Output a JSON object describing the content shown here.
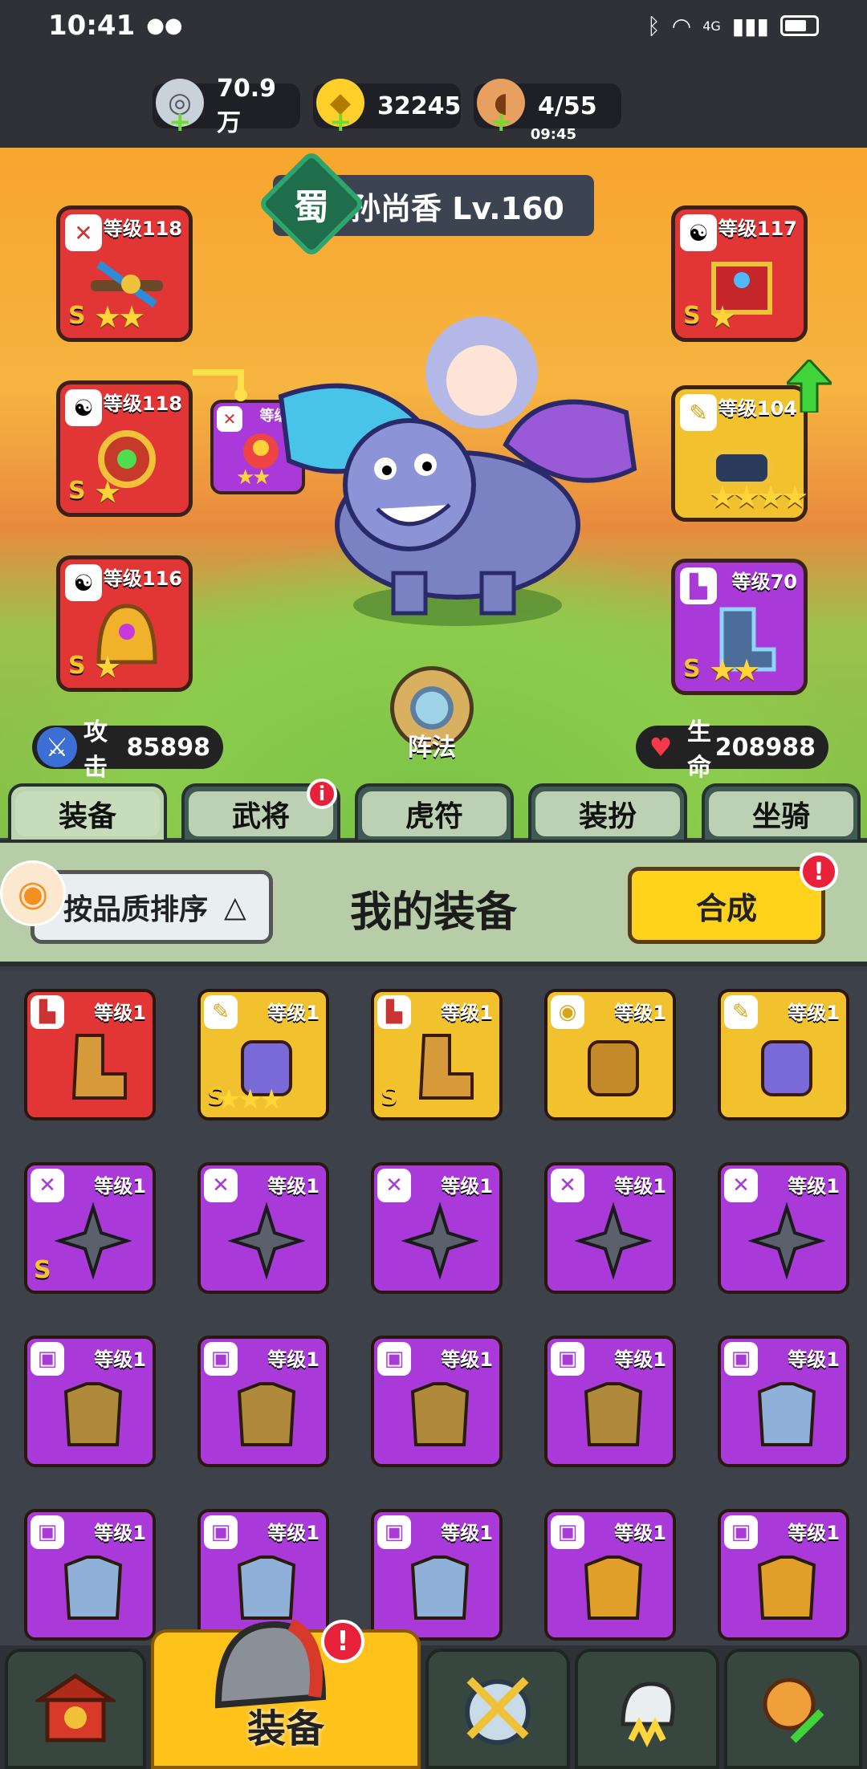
{
  "status_bar": {
    "time": "10:41",
    "network": "4G"
  },
  "resources": [
    {
      "name": "silver-coin",
      "value": "70.9万",
      "color": "#c9d2da"
    },
    {
      "name": "gold-ingot",
      "value": "32245",
      "color": "#ffcf2a"
    },
    {
      "name": "meat-stamina",
      "value": "4/55",
      "sub": "09:45",
      "color": "#e8a060"
    }
  ],
  "hero": {
    "faction": "蜀",
    "name_level": "孙尚香 Lv.160",
    "attack_label": "攻击",
    "attack_value": "85898",
    "hp_label": "生命",
    "hp_value": "208988",
    "formation_label": "阵法"
  },
  "equip_slots": {
    "weapon": {
      "level": "等级118",
      "quality": "S",
      "stars": "★★",
      "icon": "sword-tag"
    },
    "weapon_mini": {
      "level": "等级1",
      "stars": "★★",
      "icon": "sword-tag"
    },
    "helmet": {
      "level": "等级117",
      "quality": "S",
      "stars": "★",
      "icon": "yinyang-tag"
    },
    "amulet": {
      "level": "等级118",
      "quality": "S",
      "stars": "★",
      "icon": "yinyang-tag"
    },
    "bracer": {
      "level": "等级104",
      "stars": "★★★★",
      "icon": "scroll-tag"
    },
    "armor_head": {
      "level": "等级116",
      "quality": "S",
      "stars": "★",
      "icon": "yinyang-tag"
    },
    "boots": {
      "level": "等级70",
      "quality": "S",
      "stars": "★★",
      "icon": "boot-tag"
    }
  },
  "tabs": [
    {
      "label": "装备",
      "active": true
    },
    {
      "label": "武将",
      "badge": "i"
    },
    {
      "label": "虎符"
    },
    {
      "label": "装扮"
    },
    {
      "label": "坐骑"
    }
  ],
  "panel": {
    "sort_label": "按品质排序",
    "sort_arrow": "△",
    "title": "我的装备",
    "merge_label": "合成",
    "merge_badge": "!"
  },
  "inventory": [
    {
      "level": "等级1",
      "color": "red",
      "tag": "boot"
    },
    {
      "level": "等级1",
      "color": "gold",
      "tag": "scroll",
      "quality": "S",
      "stars": "★★★"
    },
    {
      "level": "等级1",
      "color": "gold",
      "tag": "boot",
      "quality": "S"
    },
    {
      "level": "等级1",
      "color": "gold",
      "tag": "medal"
    },
    {
      "level": "等级1",
      "color": "gold",
      "tag": "scroll"
    },
    {
      "level": "等级1",
      "color": "purple",
      "tag": "sword",
      "quality": "S"
    },
    {
      "level": "等级1",
      "color": "purple",
      "tag": "sword"
    },
    {
      "level": "等级1",
      "color": "purple",
      "tag": "sword"
    },
    {
      "level": "等级1",
      "color": "purple",
      "tag": "sword"
    },
    {
      "level": "等级1",
      "color": "purple",
      "tag": "sword"
    },
    {
      "level": "等级1",
      "color": "purple",
      "tag": "armor"
    },
    {
      "level": "等级1",
      "color": "purple",
      "tag": "armor"
    },
    {
      "level": "等级1",
      "color": "purple",
      "tag": "armor"
    },
    {
      "level": "等级1",
      "color": "purple",
      "tag": "armor"
    },
    {
      "level": "等级1",
      "color": "purple",
      "tag": "armor"
    },
    {
      "level": "等级1",
      "color": "purple",
      "tag": "armor"
    },
    {
      "level": "等级1",
      "color": "purple",
      "tag": "armor"
    },
    {
      "level": "等级1",
      "color": "purple",
      "tag": "armor"
    },
    {
      "level": "等级1",
      "color": "purple",
      "tag": "armor"
    },
    {
      "level": "等级1",
      "color": "purple",
      "tag": "armor"
    }
  ],
  "bottom_nav": [
    {
      "name": "home",
      "label": ""
    },
    {
      "name": "equipment",
      "label": "装备",
      "active": true,
      "badge": "!"
    },
    {
      "name": "battle",
      "label": ""
    },
    {
      "name": "heroes",
      "label": ""
    },
    {
      "name": "upgrade",
      "label": ""
    }
  ]
}
